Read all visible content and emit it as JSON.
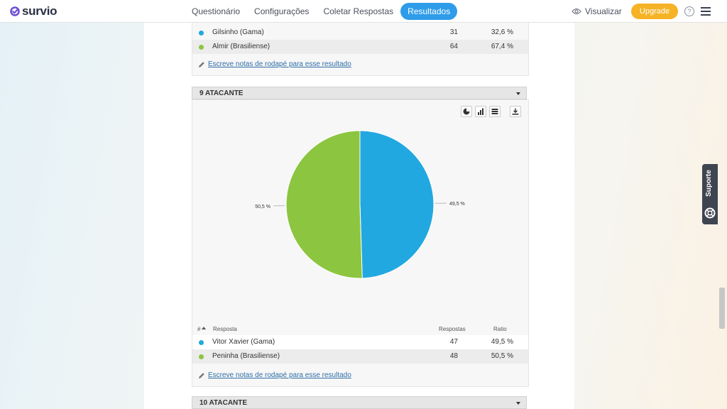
{
  "app": {
    "logo_text": "survio",
    "logo_color": "#6c4fd7"
  },
  "nav": {
    "items": [
      "Questionário",
      "Configurações",
      "Coletar Respostas",
      "Resultados"
    ],
    "active": "Resultados"
  },
  "header_right": {
    "preview_label": "Visualizar",
    "upgrade_label": "Upgrade",
    "help_symbol": "?"
  },
  "support": {
    "label": "Suporte"
  },
  "previous_question": {
    "rows": [
      {
        "name": "Gilsinho (Gama)",
        "count": "31",
        "ratio": "32,6 %",
        "color": "#22a8e0"
      },
      {
        "name": "Almir (Brasiliense)",
        "count": "64",
        "ratio": "67,4 %",
        "color": "#8cc540"
      }
    ],
    "note_link": "Escreve notas de rodapé para esse resultado"
  },
  "question": {
    "title": "9 ATACANTE",
    "table_headers": {
      "index": "#",
      "answer": "Resposta",
      "responses": "Respostas",
      "ratio": "Ratio"
    },
    "rows": [
      {
        "name": "Vitor Xavier (Gama)",
        "count": "47",
        "ratio": "49,5 %",
        "color": "#22a8e0"
      },
      {
        "name": "Peninha (Brasiliense)",
        "count": "48",
        "ratio": "50,5 %",
        "color": "#8cc540"
      }
    ],
    "note_link": "Escreve notas de rodapé para esse resultado"
  },
  "chart_data": {
    "type": "pie",
    "categories": [
      "Vitor Xavier (Gama)",
      "Peninha (Brasiliense)"
    ],
    "values": [
      49.5,
      50.5
    ],
    "labels": [
      "49,5 %",
      "50,5 %"
    ],
    "colors": [
      "#22a8e0",
      "#8cc540"
    ]
  },
  "next_question": {
    "title": "10 ATACANTE"
  },
  "icons": [
    "survio-logo-icon",
    "eye-icon",
    "help-icon",
    "hamburger-menu-icon",
    "pencil-icon",
    "pie-chart-icon",
    "bar-chart-icon",
    "table-icon",
    "download-icon",
    "lifebuoy-icon",
    "sort-up-icon",
    "caret-down-icon"
  ]
}
